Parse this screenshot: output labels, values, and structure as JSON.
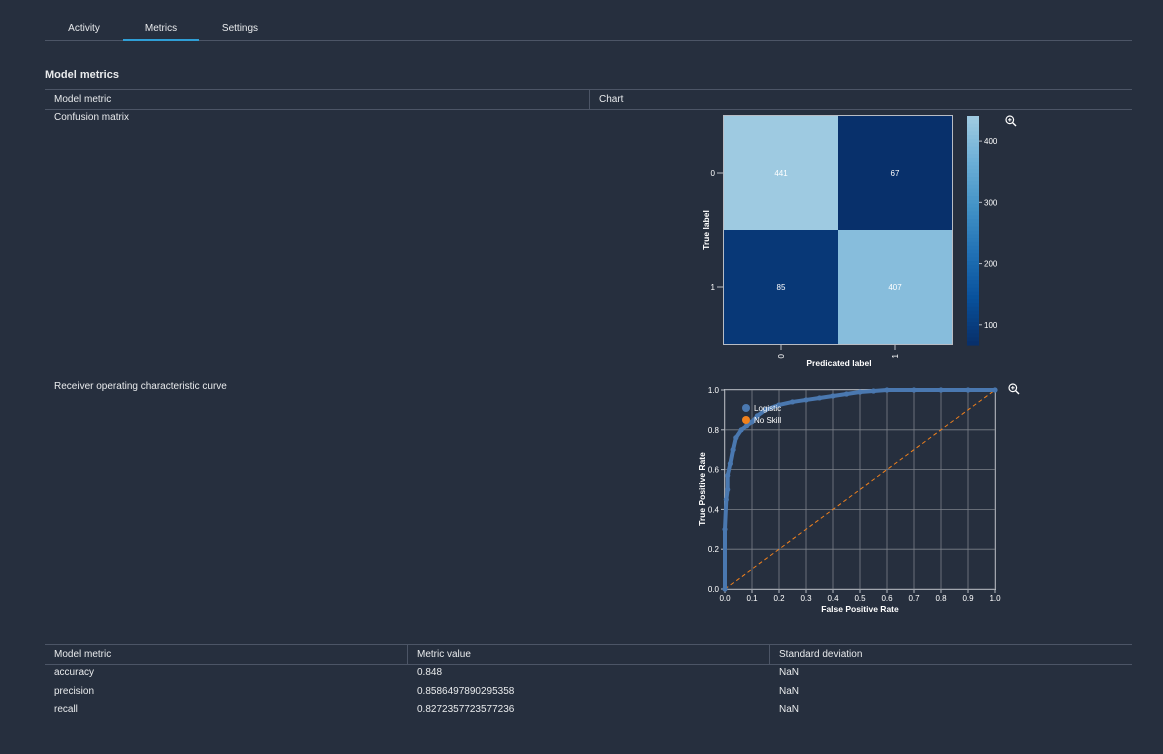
{
  "tabs": [
    {
      "label": "Activity"
    },
    {
      "label": "Metrics"
    },
    {
      "label": "Settings"
    }
  ],
  "section_title": "Model metrics",
  "chart_table": {
    "headers": [
      "Model metric",
      "Chart"
    ],
    "rows": [
      {
        "label": "Confusion matrix"
      },
      {
        "label": "Receiver operating characteristic curve"
      }
    ]
  },
  "metrics_table": {
    "headers": [
      "Model metric",
      "Metric value",
      "Standard deviation"
    ],
    "rows": [
      {
        "metric": "accuracy",
        "value": "0.848",
        "std": "NaN"
      },
      {
        "metric": "precision",
        "value": "0.8586497890295358",
        "std": "NaN"
      },
      {
        "metric": "recall",
        "value": "0.8272357723577236",
        "std": "NaN"
      }
    ]
  },
  "colors": {
    "accent": "#2f9fd6",
    "logistic": "#4a78b0",
    "no_skill": "#f0811d"
  },
  "chart_data": [
    {
      "type": "heatmap",
      "ylabel": "True label",
      "xlabel": "Predicated label",
      "x_categories": [
        "0",
        "1"
      ],
      "y_categories": [
        "0",
        "1"
      ],
      "values": [
        [
          441,
          67
        ],
        [
          85,
          407
        ]
      ],
      "colorbar_ticks": [
        100,
        200,
        300,
        400
      ],
      "colorbar_range": [
        67,
        441
      ]
    },
    {
      "type": "line",
      "xlabel": "False Positive Rate",
      "ylabel": "True Positive Rate",
      "xlim": [
        0,
        1
      ],
      "ylim": [
        0,
        1
      ],
      "x_ticks": [
        "0.0",
        "0.1",
        "0.2",
        "0.3",
        "0.4",
        "0.5",
        "0.6",
        "0.7",
        "0.8",
        "0.9",
        "1.0"
      ],
      "y_ticks": [
        "0.0",
        "0.2",
        "0.4",
        "0.6",
        "0.8",
        "1.0"
      ],
      "grid": true,
      "legend_position": "top-left",
      "series": [
        {
          "name": "Logistic",
          "x": [
            0,
            0,
            0.005,
            0.01,
            0.01,
            0.02,
            0.03,
            0.04,
            0.06,
            0.08,
            0.1,
            0.12,
            0.15,
            0.2,
            0.25,
            0.3,
            0.35,
            0.4,
            0.45,
            0.5,
            0.55,
            0.6,
            0.7,
            0.8,
            0.9,
            1.0
          ],
          "y": [
            0,
            0.3,
            0.45,
            0.5,
            0.57,
            0.63,
            0.7,
            0.76,
            0.8,
            0.82,
            0.84,
            0.87,
            0.9,
            0.925,
            0.94,
            0.95,
            0.96,
            0.97,
            0.98,
            0.99,
            0.995,
            1.0,
            1.0,
            1.0,
            1.0,
            1.0
          ]
        },
        {
          "name": "No Skill",
          "x": [
            0,
            1
          ],
          "y": [
            0,
            1
          ]
        }
      ]
    }
  ]
}
